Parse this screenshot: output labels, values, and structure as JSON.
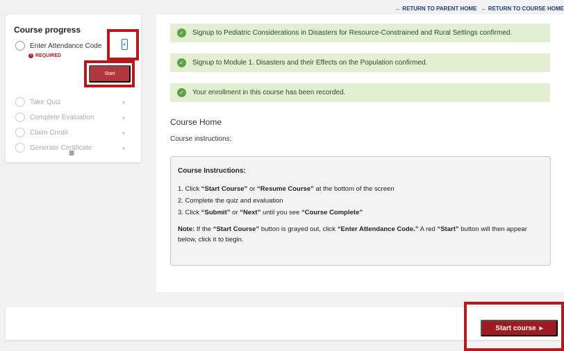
{
  "top_links": {
    "parent_home": "RETURN TO PARENT HOME",
    "course_home": "RETURN TO COURSE HOME",
    "arrow": "←"
  },
  "sidebar": {
    "title": "Course progress",
    "required_label": "REQUIRED",
    "start_label": "Start",
    "steps": [
      {
        "label": "Enter Attendance Code"
      },
      {
        "label": "Take Quiz"
      },
      {
        "label": "Complete Evaluation"
      },
      {
        "label": "Claim Credit"
      },
      {
        "label": "Generate Certificate"
      }
    ],
    "menu_icon": "≡"
  },
  "alerts": [
    "Signup to Pediatric Considerations in Disasters for Resource-Constrained and Rural Settings confirmed.",
    "Signup to Module 1. Disasters and their Effects on the Population confirmed.",
    "Your enrollment in this course has been recorded."
  ],
  "main": {
    "course_home": "Course Home",
    "instructions_label": "Course instructions:",
    "box_title": "Course Instructions:",
    "line1_pre": "1. Click ",
    "line1_b1": "“Start Course”",
    "line1_mid": " or ",
    "line1_b2": "“Resume Course”",
    "line1_post": " at the bottom of the screen",
    "line2": "2. Complete the quiz and evaluation",
    "line3_pre": "3. Click ",
    "line3_b1": "“Submit”",
    "line3_mid1": " or ",
    "line3_b2": "“Next”",
    "line3_mid2": " until you see ",
    "line3_b3": "“Course Complete”",
    "note_label": "Note:",
    "note_pre": " If the ",
    "note_b1": "“Start Course”",
    "note_mid1": " button is grayed out, click ",
    "note_b2": "“Enter Attendance Code.”",
    "note_mid2": " A red ",
    "note_b3": "“Start”",
    "note_post": " button will then appear below, click it to begin."
  },
  "footer": {
    "start_course": "Start course",
    "arrow": "▸"
  },
  "colors": {
    "accent": "#9e1b1f",
    "highlight_box": "#b7181c",
    "alert_bg": "#e2efd3",
    "link": "#1b3f73"
  }
}
